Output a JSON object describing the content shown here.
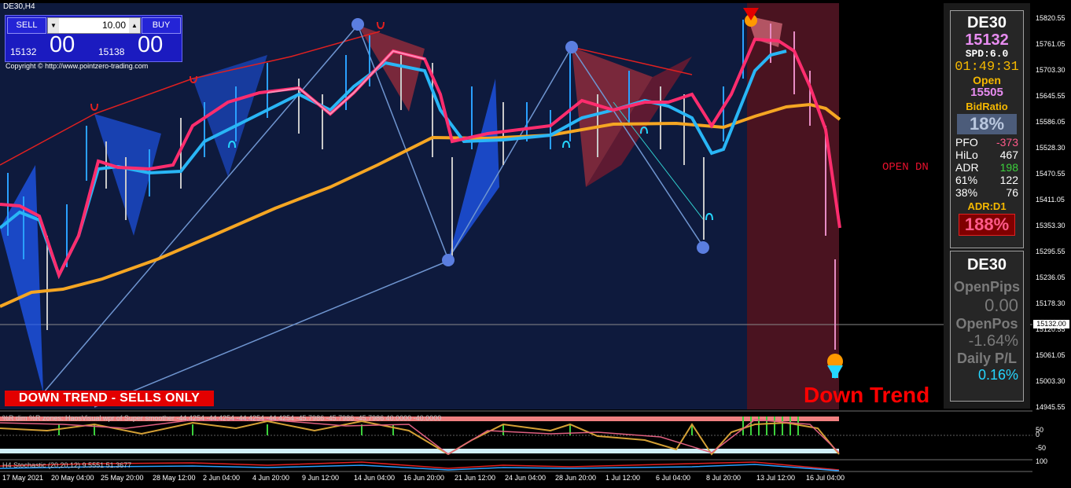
{
  "window": {
    "symbol": "DE30,H4"
  },
  "trade_widget": {
    "sell_label": "SELL",
    "buy_label": "BUY",
    "lot_value": "10.00",
    "bid_prefix": "15132",
    "bid_big": "00",
    "ask_prefix": "15138",
    "ask_big": "00"
  },
  "copyright": "Copyright © http://www.pointzero-trading.com",
  "banner_text": "DOWN TREND - SELLS ONLY",
  "signal_label": "OPEN DN",
  "trend_label": "Down Trend",
  "panel1": {
    "symbol": "DE30",
    "price": "15132",
    "spread": "SPD:6.0",
    "countdown": "01:49:31",
    "open_label": "Open",
    "open_value": "15505",
    "bidratio_label": "BidRatio",
    "bidratio_value": "18%",
    "stats": [
      {
        "label": "PFO",
        "value": "-373"
      },
      {
        "label": "HiLo",
        "value": "467"
      },
      {
        "label": "ADR",
        "value": "198"
      },
      {
        "label": "61%",
        "value": "122"
      },
      {
        "label": "38%",
        "value": "76"
      }
    ],
    "adr_label": "ADR:D1",
    "adr_pct": "188%"
  },
  "panel2": {
    "symbol": "DE30",
    "openpips_label": "OpenPips",
    "openpips_value": "0.00",
    "openpos_label": "OpenPos",
    "openpos_value": "-1.64%",
    "daily_label": "Daily P/L",
    "daily_value": "0.16%"
  },
  "price_axis": {
    "ticks": [
      "15820.55",
      "15761.05",
      "15703.30",
      "15645.55",
      "15586.05",
      "15528.30",
      "15470.55",
      "15411.05",
      "15353.30",
      "15295.55",
      "15236.05",
      "15178.30",
      "15120.55",
      "15061.05",
      "15003.30",
      "14945.55"
    ],
    "current": "15132.00"
  },
  "indicator1": {
    "label": "%R dim %R zones: HaosVisual wpr of Super smoother -44.4254 -44.4254 -44.4254 -44.4254 -45.7986 -45.7986 -45.7986 40.0000 -40.0000",
    "ticks": [
      "100",
      "50",
      "0",
      "-50",
      "-100"
    ]
  },
  "indicator2": {
    "label": "H4 Stochastic (20,20,12) 9.5551 51.3677",
    "ticks": [
      "100",
      "0"
    ]
  },
  "time_axis": [
    "17 May 2021",
    "20 May 04:00",
    "25 May 20:00",
    "28 May 12:00",
    "2 Jun 04:00",
    "4 Jun 20:00",
    "9 Jun 12:00",
    "14 Jun 04:00",
    "16 Jun 20:00",
    "21 Jun 12:00",
    "24 Jun 04:00",
    "28 Jun 20:00",
    "1 Jul 12:00",
    "6 Jul 04:00",
    "8 Jul 20:00",
    "13 Jul 12:00",
    "16 Jul 04:00"
  ],
  "colors": {
    "chart_bg": "#0e1a3d",
    "red_zone": "#4a1320",
    "fast_ma_up": "#29b6f6",
    "fast_ma_dn": "#ff2d6e",
    "slow_ma": "#f5a623",
    "signal_red": "#e30000"
  }
}
